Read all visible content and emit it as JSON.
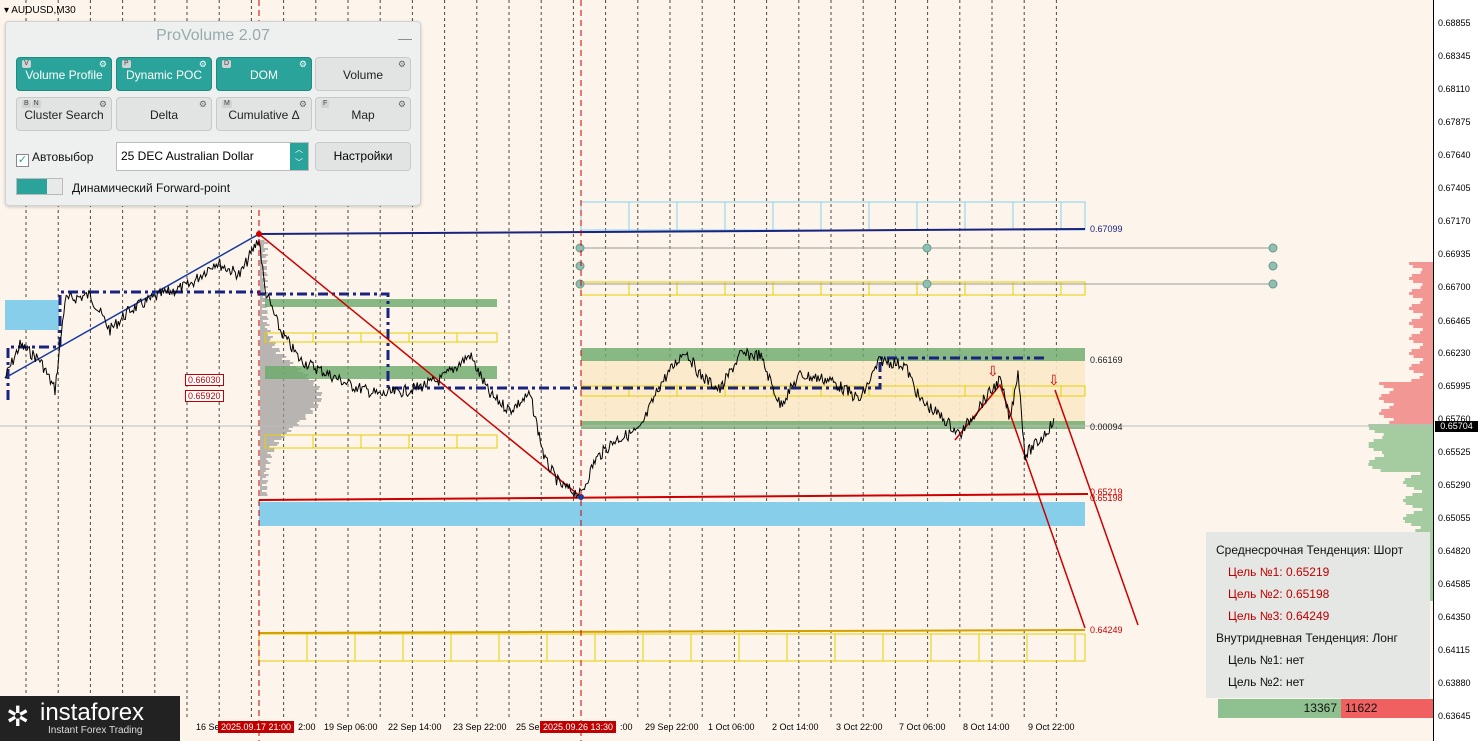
{
  "window": {
    "symbol_label": "AUDUSD,M30"
  },
  "colors": {
    "background": "#fdf5ec",
    "accent": "#2aa39a",
    "trend_line_red": "#cc0000",
    "level_blue": "#1a237e",
    "zone_blue": "#87ceeb",
    "zone_green": "#6aaa6a",
    "zone_yellow": "#e8d000"
  },
  "provolume": {
    "title": "ProVolume 2.07",
    "minimize_label": "—",
    "buttons": [
      {
        "label": "Volume Profile",
        "keys": [
          "V"
        ],
        "active": true
      },
      {
        "label": "Dynamic POC",
        "keys": [
          "P"
        ],
        "active": true
      },
      {
        "label": "DOM",
        "keys": [
          "D"
        ],
        "active": true
      },
      {
        "label": "Volume",
        "keys": [],
        "active": false
      },
      {
        "label": "Cluster Search",
        "keys": [
          "B",
          "N"
        ],
        "active": false
      },
      {
        "label": "Delta",
        "keys": [],
        "active": false
      },
      {
        "label": "Cumulative Δ",
        "keys": [
          "M"
        ],
        "active": false
      },
      {
        "label": "Map",
        "keys": [
          "F"
        ],
        "active": false
      }
    ],
    "autoselect_label": "Автовыбор",
    "autoselect_checked": true,
    "instrument_value": "25 DEC Australian Dollar",
    "settings_label": "Настройки",
    "forward_point_label": "Динамический Forward-point"
  },
  "price_axis": {
    "ticks": [
      "0.68855",
      "0.68345",
      "0.68110",
      "0.67875",
      "0.67640",
      "0.67405",
      "0.67170",
      "0.66935",
      "0.66700",
      "0.66465",
      "0.66230",
      "0.65995",
      "0.65760",
      "0.65525",
      "0.65290",
      "0.65055",
      "0.64820",
      "0.64585",
      "0.64350",
      "0.64115",
      "0.63880",
      "0.63645"
    ],
    "current_price": "0.65704"
  },
  "time_axis": {
    "ticks": [
      "16 Se",
      "2:00",
      "19 Sep 06:00",
      "22 Sep 14:00",
      "23 Sep 22:00",
      "25 Se",
      ":00",
      "29 Sep 22:00",
      "1 Oct 06:00",
      "2 Oct 14:00",
      "3 Oct 22:00",
      "7 Oct 06:00",
      "8 Oct 14:00",
      "9 Oct 22:00"
    ],
    "highlighted": [
      "2025.09.17 21:00",
      "2025.09.26 13:30"
    ]
  },
  "chart_levels": {
    "top_level": "0.67099",
    "upper_zone": "0.66169",
    "mid_level": "0.00094",
    "support_a": "0.65219",
    "support_b": "0.65198",
    "bottom_level": "0.64249",
    "box_a": "0.66030",
    "box_b": "0.65920"
  },
  "trend_panel": {
    "medium_term": "Среднесрочная Тенденция: Шорт",
    "targets": [
      "Цель №1: 0.65219",
      "Цель №2: 0.65198",
      "Цель №3: 0.64249"
    ],
    "intraday": "Внутридневная Тенденция: Лонг",
    "intraday_targets": [
      "Цель №1: нет",
      "Цель №2: нет"
    ]
  },
  "volume_bar": {
    "buy": "13367",
    "sell": "11622"
  },
  "logo": {
    "name": "instaforex",
    "tagline": "Instant Forex Trading"
  }
}
